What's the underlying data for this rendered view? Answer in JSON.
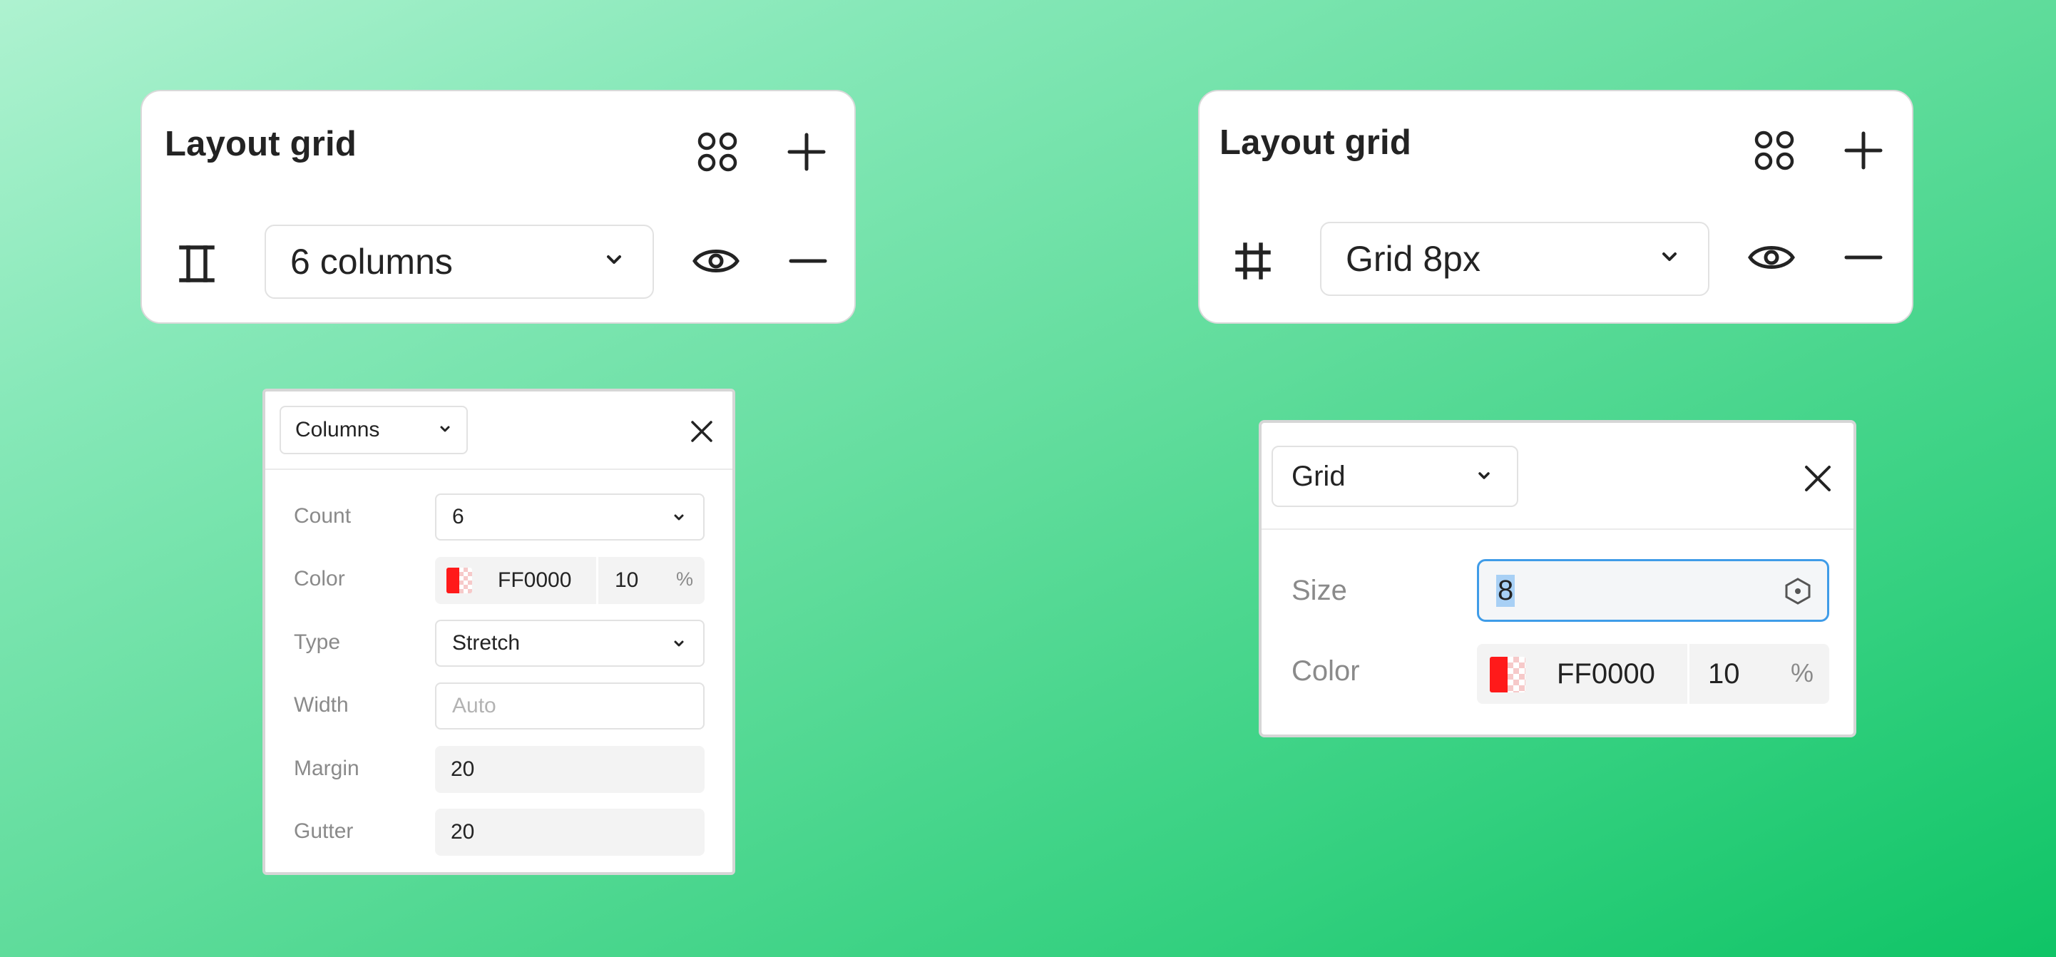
{
  "left_panel": {
    "title": "Layout grid",
    "grid_type_value": "6 columns"
  },
  "right_panel": {
    "title": "Layout grid",
    "grid_type_value": "Grid 8px"
  },
  "columns_popup": {
    "type_value": "Columns",
    "rows": {
      "count": {
        "label": "Count",
        "value": "6"
      },
      "color": {
        "label": "Color",
        "hex": "FF0000",
        "opacity": "10",
        "unit": "%"
      },
      "type": {
        "label": "Type",
        "value": "Stretch"
      },
      "width": {
        "label": "Width",
        "placeholder": "Auto"
      },
      "margin": {
        "label": "Margin",
        "value": "20"
      },
      "gutter": {
        "label": "Gutter",
        "value": "20"
      }
    }
  },
  "grid_popup": {
    "type_value": "Grid",
    "rows": {
      "size": {
        "label": "Size",
        "value": "8"
      },
      "color": {
        "label": "Color",
        "hex": "FF0000",
        "opacity": "10",
        "unit": "%"
      }
    }
  },
  "colors": {
    "swatch": "#ff0000",
    "focus_ring": "#3f9ce8",
    "selection": "#a8d0f5"
  },
  "icons": [
    "style-grid-icon",
    "plus-icon",
    "columns-grid-icon",
    "square-grid-icon",
    "chevron-down-icon",
    "eye-icon",
    "minus-icon",
    "close-icon",
    "hexagon-icon"
  ]
}
